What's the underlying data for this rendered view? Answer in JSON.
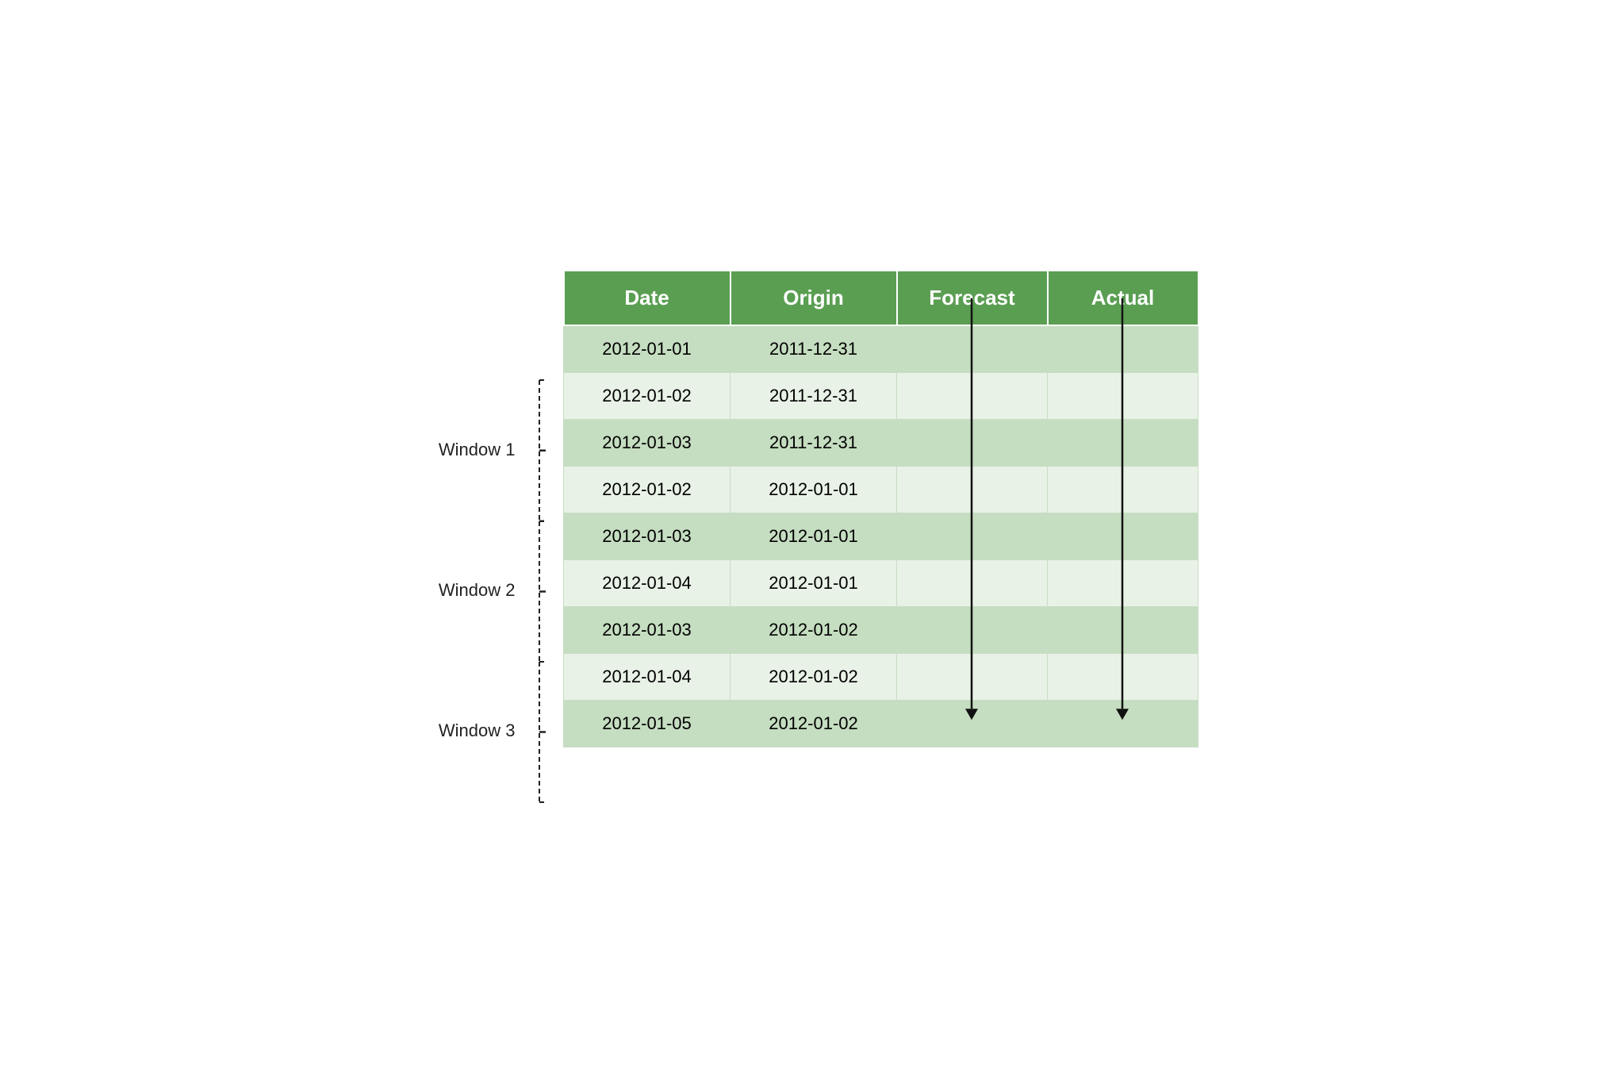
{
  "header": {
    "date_label": "Date",
    "origin_label": "Origin",
    "forecast_label": "Forecast",
    "actual_label": "Actual"
  },
  "windows": [
    {
      "label": "Window 1",
      "rows": [
        {
          "date": "2012-01-01",
          "origin": "2011-12-31",
          "shade": "dark"
        },
        {
          "date": "2012-01-02",
          "origin": "2011-12-31",
          "shade": "light"
        },
        {
          "date": "2012-01-03",
          "origin": "2011-12-31",
          "shade": "dark"
        }
      ]
    },
    {
      "label": "Window 2",
      "rows": [
        {
          "date": "2012-01-02",
          "origin": "2012-01-01",
          "shade": "light"
        },
        {
          "date": "2012-01-03",
          "origin": "2012-01-01",
          "shade": "dark"
        },
        {
          "date": "2012-01-04",
          "origin": "2012-01-01",
          "shade": "light"
        }
      ]
    },
    {
      "label": "Window 3",
      "rows": [
        {
          "date": "2012-01-03",
          "origin": "2012-01-02",
          "shade": "dark"
        },
        {
          "date": "2012-01-04",
          "origin": "2012-01-02",
          "shade": "light"
        },
        {
          "date": "2012-01-05",
          "origin": "2012-01-02",
          "shade": "dark"
        }
      ]
    }
  ],
  "colors": {
    "header_bg": "#5a9e52",
    "row_dark": "#c5ddc0",
    "row_light": "#e8f2e6",
    "arrow": "#111111"
  }
}
